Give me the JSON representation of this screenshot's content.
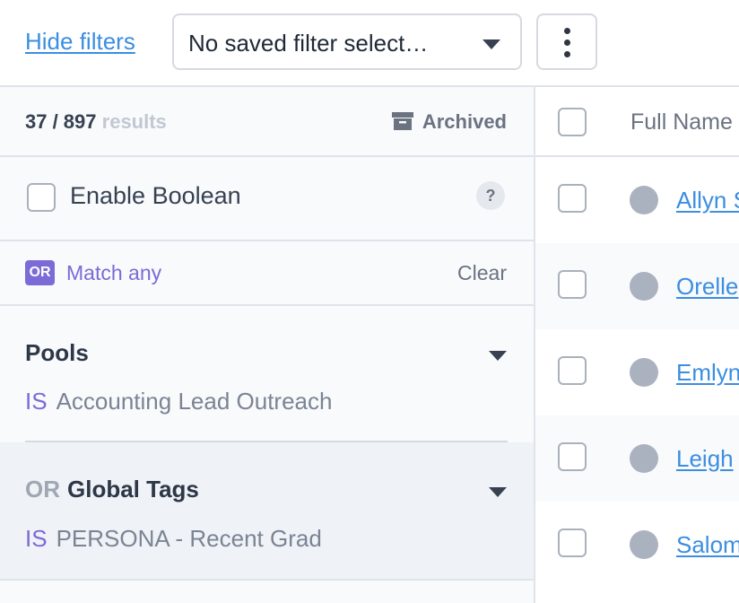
{
  "topbar": {
    "hide_filters": "Hide filters",
    "saved_filter_value": "No saved filter select…",
    "more_icon": "kebab-vertical-icon"
  },
  "filters": {
    "results_count": "37 / 897",
    "results_word": "results",
    "archived_label": "Archived",
    "boolean_label": "Enable Boolean",
    "help_glyph": "?",
    "match_badge": "OR",
    "match_label": "Match any",
    "clear_label": "Clear",
    "groups": [
      {
        "title": "Pools",
        "operator": "IS",
        "value": "Accounting Lead Outreach"
      },
      {
        "prefix": "OR",
        "title": "Global Tags",
        "operator": "IS",
        "value": "PERSONA - Recent Grad"
      }
    ]
  },
  "table": {
    "column_full_name": "Full Name",
    "rows": [
      {
        "name": "Allyn S"
      },
      {
        "name": "Orelle"
      },
      {
        "name": "Emlyn"
      },
      {
        "name": "Leigh"
      },
      {
        "name": "Salom"
      }
    ]
  },
  "colors": {
    "link": "#3b8ee0",
    "accent_purple": "#7c6ad6",
    "border": "#dfe3ea"
  }
}
